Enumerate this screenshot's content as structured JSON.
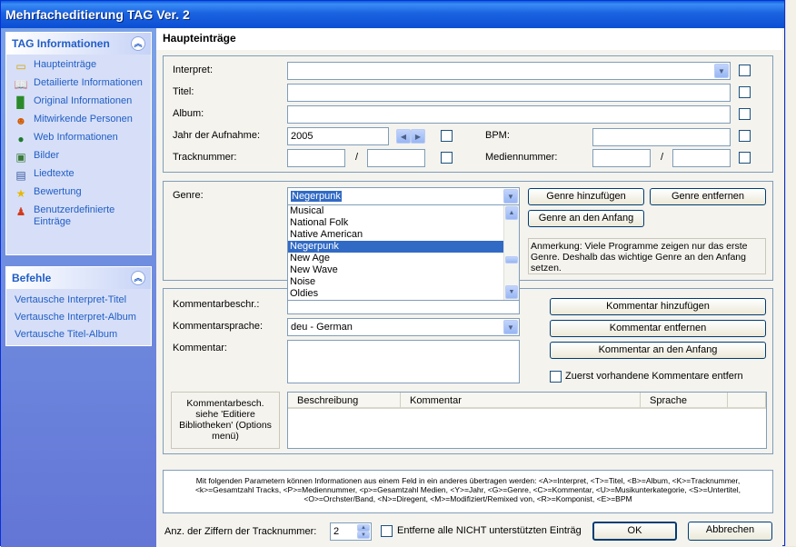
{
  "window": {
    "title": "Mehrfacheditierung TAG Ver. 2"
  },
  "sidebar": {
    "tag_panel": {
      "title": "TAG Informationen",
      "items": [
        {
          "label": "Haupteinträge",
          "icon": "folder-note-icon"
        },
        {
          "label": "Detailierte Informationen",
          "icon": "book-icon"
        },
        {
          "label": "Original Informationen",
          "icon": "green-book-icon"
        },
        {
          "label": "Mitwirkende Personen",
          "icon": "people-icon"
        },
        {
          "label": "Web Informationen",
          "icon": "globe-icon"
        },
        {
          "label": "Bilder",
          "icon": "picture-icon"
        },
        {
          "label": "Liedtexte",
          "icon": "document-icon"
        },
        {
          "label": "Bewertung",
          "icon": "star-icon"
        },
        {
          "label": "Benutzerdefinierte Einträge",
          "icon": "person-icon"
        }
      ]
    },
    "cmd_panel": {
      "title": "Befehle",
      "items": [
        {
          "label": "Vertausche Interpret-Titel"
        },
        {
          "label": "Vertausche Interpret-Album"
        },
        {
          "label": "Vertausche Titel-Album"
        }
      ]
    }
  },
  "main": {
    "title": "Haupteinträge",
    "fields": {
      "interpret": "Interpret:",
      "titel": "Titel:",
      "album": "Album:",
      "jahr": "Jahr der Aufnahme:",
      "jahr_value": "2005",
      "bpm": "BPM:",
      "track": "Tracknummer:",
      "slash": "/",
      "medien": "Mediennummer:"
    },
    "genre": {
      "label": "Genre:",
      "value": "Negerpunk",
      "options": [
        "Musical",
        "National Folk",
        "Native American",
        "Negerpunk",
        "New Age",
        "New Wave",
        "Noise",
        "Oldies"
      ],
      "selected_index": 3,
      "add_button": "Genre hinzufügen",
      "remove_button": "Genre entfernen",
      "first_button": "Genre an den Anfang",
      "note": "Anmerkung: Viele Programme zeigen nur das erste Genre. Deshalb das wichtige Genre an den Anfang setzen."
    },
    "comment": {
      "desc_label": "Kommentarbeschr.:",
      "lang_label": "Kommentarsprache:",
      "lang_value": "deu - German",
      "comment_label": "Kommentar:",
      "add_button": "Kommentar hinzufügen",
      "remove_button": "Kommentar entfernen",
      "first_button": "Kommentar an den Anfang",
      "first_check": "Zuerst vorhandene Kommentare entfern",
      "info_text": "Kommentarbesch. siehe 'Editiere Bibliotheken' (Options menü)",
      "columns": [
        "Beschreibung",
        "Kommentar",
        "Sprache"
      ]
    },
    "params_text": "Mit folgenden Parametern können Informationen aus einem Feld in ein anderes übertragen werden: <A>=Interpret, <T>=Titel, <B>=Album, <K>=Tracknummer, <k>=Gesamtzahl Tracks, <P>=Mediennummer, <p>=Gesamtzahl Medien, <Y>=Jahr, <G>=Genre, <C>=Kommentar, <U>=Musikunterkategorie, <S>=Untertitel, <O>=Orchster/Band, <N>=Diregent, <M>=Modifiziert/Remixed von, <R>=Komponist, <E>=BPM",
    "bottom": {
      "digits_label": "Anz. der Ziffern der Tracknummer:",
      "digits_value": "2",
      "remove_check": "Entferne alle NICHT unterstützten Einträg",
      "ok": "OK",
      "cancel": "Abbrechen"
    }
  }
}
